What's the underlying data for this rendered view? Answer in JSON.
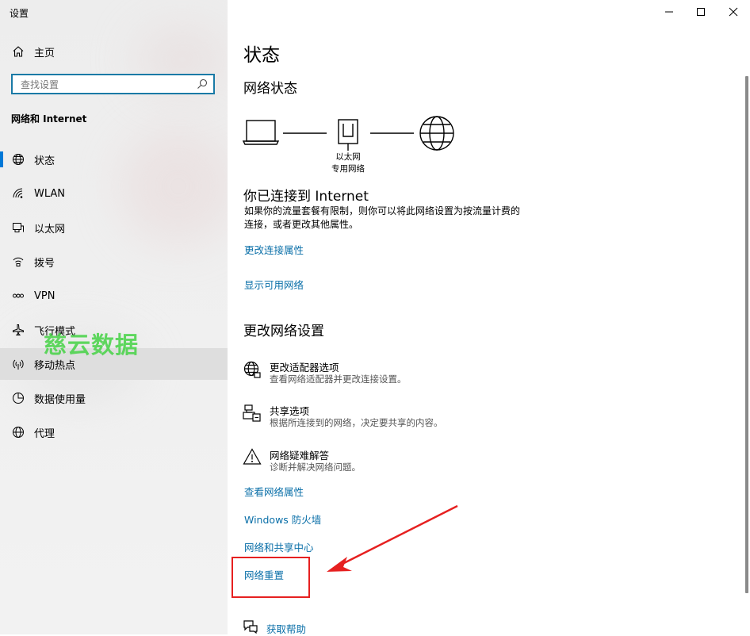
{
  "window": {
    "title": "设置",
    "controls": [
      "minimize",
      "maximize",
      "close"
    ]
  },
  "sidebar": {
    "home_label": "主页",
    "search_placeholder": "查找设置",
    "section_heading": "网络和 Internet",
    "items": [
      {
        "label": "状态",
        "icon": "globe-status-icon",
        "active": true
      },
      {
        "label": "WLAN",
        "icon": "wifi-icon"
      },
      {
        "label": "以太网",
        "icon": "ethernet-icon"
      },
      {
        "label": "拨号",
        "icon": "dialup-icon"
      },
      {
        "label": "VPN",
        "icon": "vpn-icon"
      },
      {
        "label": "飞行模式",
        "icon": "airplane-icon"
      },
      {
        "label": "移动热点",
        "icon": "hotspot-icon"
      },
      {
        "label": "数据使用量",
        "icon": "data-usage-icon"
      },
      {
        "label": "代理",
        "icon": "proxy-globe-icon"
      }
    ]
  },
  "watermark": "慈云数据",
  "main": {
    "title": "状态",
    "network_status_heading": "网络状态",
    "diagram_label_line1": "以太网",
    "diagram_label_line2": "专用网络",
    "connected_heading": "你已连接到 Internet",
    "connected_desc_line1": "如果你的流量套餐有限制，则你可以将此网络设置为按流量计费的",
    "connected_desc_line2": "连接，或者更改其他属性。",
    "links_top": [
      "更改连接属性",
      "显示可用网络"
    ],
    "change_heading": "更改网络设置",
    "options": [
      {
        "title": "更改适配器选项",
        "desc": "查看网络适配器并更改连接设置。",
        "icon": "adapter-globe-icon"
      },
      {
        "title": "共享选项",
        "desc": "根据所连接到的网络，决定要共享的内容。",
        "icon": "sharing-icon"
      },
      {
        "title": "网络疑难解答",
        "desc": "诊断并解决网络问题。",
        "icon": "warning-icon"
      }
    ],
    "links_bottom": [
      "查看网络属性",
      "Windows 防火墙",
      "网络和共享中心",
      "网络重置"
    ],
    "help_label": "获取帮助"
  },
  "colors": {
    "accent": "#0078d7",
    "link": "#0a6fa8",
    "annotation": "#e62020",
    "watermark": "#46d346"
  }
}
